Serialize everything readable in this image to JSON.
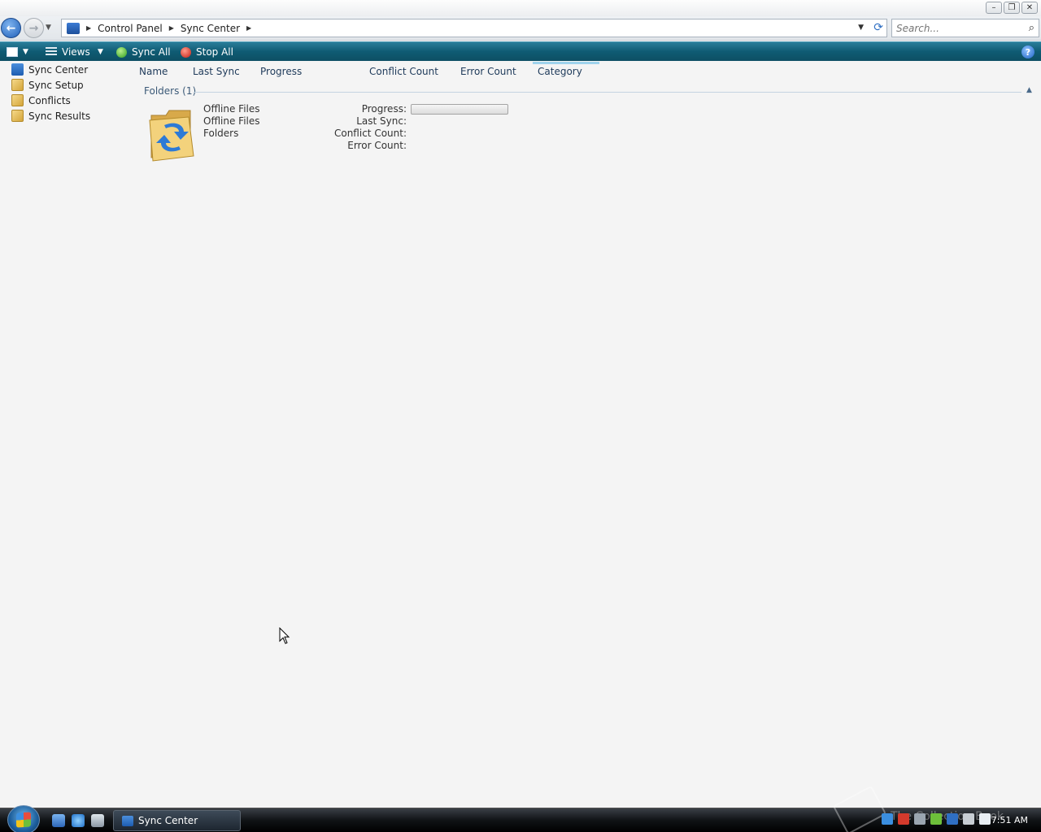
{
  "window": {
    "minimize": "–",
    "restore": "❐",
    "close": "✕"
  },
  "address": {
    "crumbs": [
      "Control Panel",
      "Sync Center"
    ],
    "search_placeholder": "Search..."
  },
  "toolbar": {
    "views_label": "Views",
    "sync_all_label": "Sync All",
    "stop_all_label": "Stop All",
    "help_label": "?"
  },
  "sidebar": {
    "items": [
      {
        "label": "Sync Center",
        "icon": "sync-center-icon"
      },
      {
        "label": "Sync Setup",
        "icon": "folder-icon"
      },
      {
        "label": "Conflicts",
        "icon": "folder-icon"
      },
      {
        "label": "Sync Results",
        "icon": "folder-icon"
      }
    ]
  },
  "columns": [
    "Name",
    "Last Sync",
    "Progress",
    "Conflict Count",
    "Error Count",
    "Category"
  ],
  "group": {
    "title": "Folders (1)"
  },
  "item": {
    "name": "Offline Files",
    "line2": "Offline Files",
    "line3": "Folders",
    "props": {
      "progress_label": "Progress:",
      "last_sync_label": "Last Sync:",
      "conflict_label": "Conflict Count:",
      "error_label": "Error Count:"
    },
    "progress_value": 0
  },
  "taskbar": {
    "task_label": "Sync Center",
    "clock": "7:51 AM",
    "watermark": "The Collection Book"
  },
  "colors": {
    "command_bar": "#0f5b73",
    "accent": "#2f6fc3"
  }
}
